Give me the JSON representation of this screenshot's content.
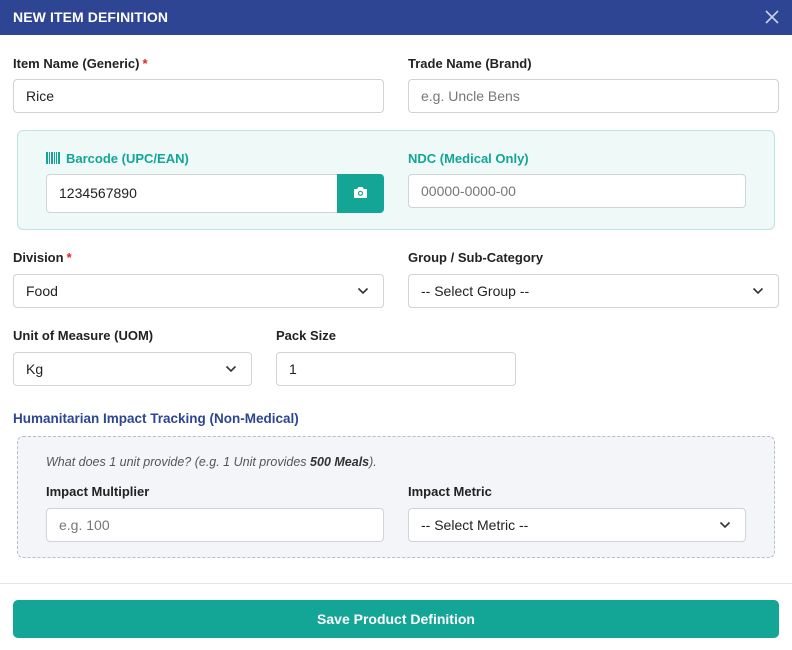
{
  "header": {
    "title": "NEW ITEM DEFINITION"
  },
  "item_name": {
    "label": "Item Name (Generic)",
    "required": "*",
    "value": "Rice"
  },
  "trade_name": {
    "label": "Trade Name (Brand)",
    "placeholder": "e.g. Uncle Bens"
  },
  "barcode": {
    "label": "Barcode (UPC/EAN)",
    "value": "1234567890"
  },
  "ndc": {
    "label": "NDC (Medical Only)",
    "placeholder": "00000-0000-00"
  },
  "division": {
    "label": "Division",
    "required": "*",
    "selected": "Food"
  },
  "group": {
    "label": "Group / Sub-Category",
    "selected": "-- Select Group --"
  },
  "uom": {
    "label": "Unit of Measure (UOM)",
    "selected": "Kg"
  },
  "pack_size": {
    "label": "Pack Size",
    "value": "1"
  },
  "impact": {
    "section_title": "Humanitarian Impact Tracking (Non-Medical)",
    "hint_prefix": "What does 1 unit provide? (e.g. 1 Unit provides ",
    "hint_bold": "500 Meals",
    "hint_suffix": ").",
    "multiplier_label": "Impact Multiplier",
    "multiplier_placeholder": "e.g. 100",
    "metric_label": "Impact Metric",
    "metric_selected": "-- Select Metric --"
  },
  "footer": {
    "save_label": "Save Product Definition"
  },
  "colors": {
    "header": "#2e4593",
    "accent": "#13a596",
    "required": "#e02424"
  },
  "icons": [
    "close-icon",
    "barcode-icon",
    "camera-icon",
    "chevron-down-icon"
  ]
}
